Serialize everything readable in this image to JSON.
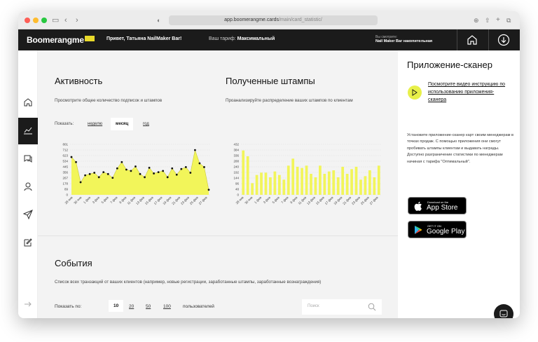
{
  "browser": {
    "url_domain": "app.boomerangme.cards",
    "url_path": "/main/card_statistic/"
  },
  "header": {
    "logo": "Boomerangme",
    "greeting": "Привет, Татьяна NailMaker Bar!",
    "tariff_label": "Ваш тариф:",
    "tariff_value": "Максимальный",
    "viewing_label": "Вы смотрите:",
    "viewing_value": "Nail Maker Bar накопительная",
    "icons": [
      "home-icon",
      "download-icon"
    ]
  },
  "sidebar": {
    "items": [
      "home-icon",
      "chart-icon",
      "chat-icon",
      "user-icon",
      "send-icon",
      "edit-icon",
      "arrow-right-icon"
    ],
    "active": 1
  },
  "activity": {
    "title": "Активность",
    "subtitle": "Просмотрите общее количество подписок и штампов",
    "show_label": "Показать:",
    "periods": [
      "неделю",
      "месяц",
      "год"
    ],
    "active_period": "месяц"
  },
  "stamps": {
    "title": "Полученные штампы",
    "subtitle": "Проанализируйте распределение ваших штампов по клиентам"
  },
  "events": {
    "title": "События",
    "subtitle": "Список всех транзакций от ваших клиентов (например, новые регистрации, заработанные штампы, заработанные вознаграждения)",
    "show_by": "Показать по:",
    "page_sizes": [
      "10",
      "20",
      "50",
      "100"
    ],
    "active_size": "10",
    "users_label": "пользователей",
    "search_placeholder": "Поиск"
  },
  "scanner": {
    "title": "Приложение-сканер",
    "video_link": "Посмотрите видео инструкцию по использованию приложения-сканера",
    "description": "Установите приложение-сканер карт своим менеджерам в точках продаж. С помощью приложения они смогут пробивать штампы клиентам и выдавать награды. Доступно разграничение статистики по менеджерам начиная с тарифа \"Оптимальный\".",
    "appstore_small": "Download on the",
    "appstore_big": "App Store",
    "gplay_small": "GET IT ON",
    "gplay_big": "Google Play"
  },
  "chart_data": [
    {
      "type": "area",
      "color": "#f2f55a",
      "categories": [
        "28 янв",
        "30 янв",
        "1 фев",
        "3 фев",
        "5 фев",
        "7 фев",
        "9 фев",
        "11 фев",
        "13 фев",
        "15 фев",
        "17 фев",
        "19 фев",
        "21 фев",
        "23 фев",
        "25 фев",
        "27 фев"
      ],
      "y_ticks": [
        "0",
        "89",
        "178",
        "267",
        "356",
        "445",
        "534",
        "623",
        "712",
        "801"
      ],
      "ylim": [
        0,
        801
      ],
      "values": [
        600,
        520,
        200,
        310,
        330,
        350,
        280,
        360,
        330,
        270,
        420,
        520,
        400,
        380,
        450,
        330,
        280,
        430,
        340,
        360,
        380,
        280,
        420,
        320,
        410,
        440,
        350,
        710,
        500,
        440,
        80
      ]
    },
    {
      "type": "bar",
      "color": "#f2f55a",
      "categories": [
        "28 янв",
        "30 янв",
        "1 фев",
        "3 фев",
        "5 фев",
        "7 фев",
        "9 фев",
        "11 фев",
        "13 фев",
        "15 фев",
        "17 фев",
        "19 фев",
        "21 фев",
        "23 фев",
        "25 фев",
        "27 фев"
      ],
      "y_ticks": [
        "0",
        "48",
        "96",
        "144",
        "192",
        "240",
        "288",
        "336",
        "384",
        "432"
      ],
      "ylim": [
        0,
        432
      ],
      "values": [
        380,
        330,
        100,
        170,
        190,
        190,
        150,
        200,
        170,
        130,
        250,
        310,
        240,
        230,
        250,
        180,
        150,
        250,
        180,
        200,
        210,
        150,
        240,
        180,
        220,
        240,
        130,
        160,
        210,
        150,
        250
      ]
    }
  ]
}
